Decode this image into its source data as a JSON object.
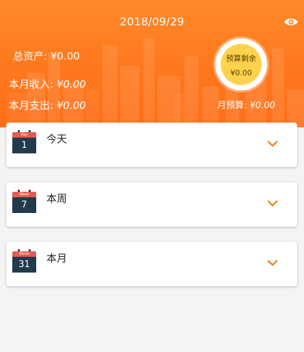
{
  "header": {
    "date": "2018/09/29",
    "total_assets_label": "总资产:",
    "total_assets_value": "¥0.00",
    "month_income_label": "本月收入:",
    "month_income_value": "¥0.00",
    "month_expense_label": "本月支出:",
    "month_expense_value": "¥0.00",
    "budget_remaining_title": "预算剩余",
    "budget_remaining_value": "¥0.00",
    "month_budget_label": "月预算:",
    "month_budget_value": "¥0.00"
  },
  "cards": [
    {
      "title": "今天",
      "calendar_tag": "Day",
      "calendar_number": "1"
    },
    {
      "title": "本周",
      "calendar_tag": "Week",
      "calendar_number": "7"
    },
    {
      "title": "本月",
      "calendar_tag": "Month",
      "calendar_number": "31"
    }
  ],
  "colors": {
    "header_orange": "#ff7a1f",
    "budget_yellow": "#ffd24d",
    "chevron_orange": "#f08a24",
    "calendar_red": "#e65a4f",
    "calendar_navy": "#213b4d"
  },
  "icons": {
    "visibility": "eye-icon",
    "calendar": "calendar-icon",
    "expand": "chevron-down-icon"
  }
}
